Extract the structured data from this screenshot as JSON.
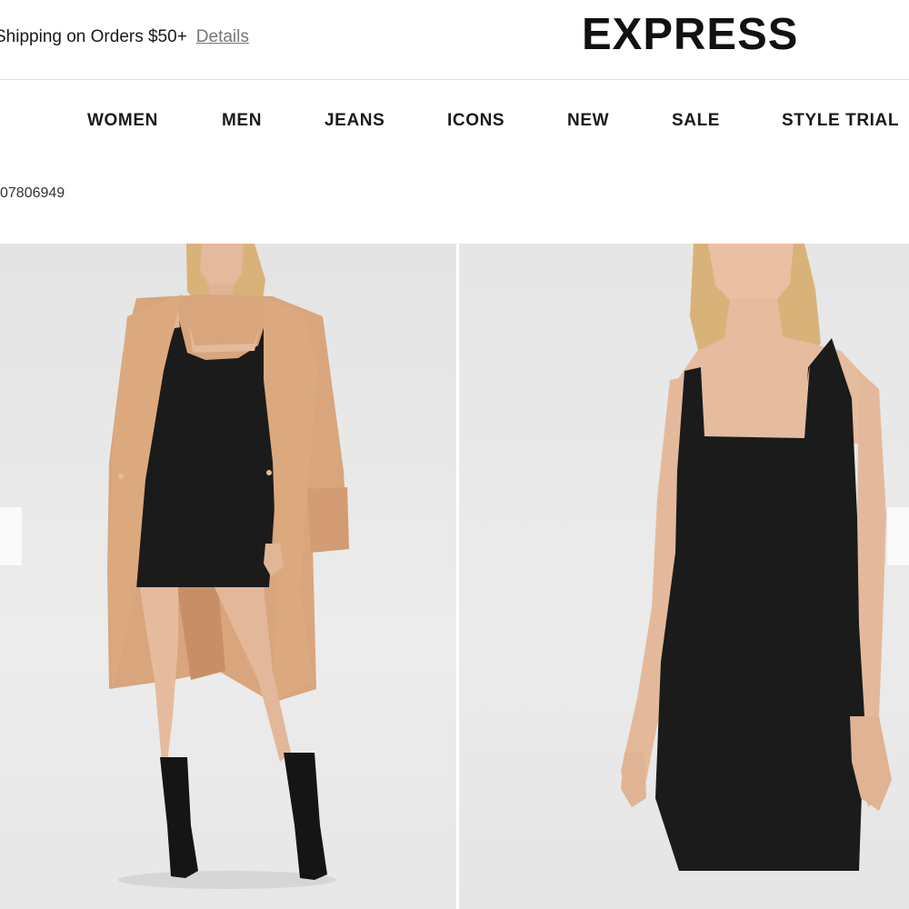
{
  "header": {
    "promo_text": "Shipping on Orders $50+",
    "promo_link": "Details",
    "logo": "EXPRESS"
  },
  "nav": {
    "items": [
      "WOMEN",
      "MEN",
      "JEANS",
      "ICONS",
      "NEW",
      "SALE",
      "STYLE TRIAL"
    ]
  },
  "product": {
    "style_number": "07806949"
  },
  "gallery": {
    "icons": {
      "prev": "chevron-left-icon",
      "next": "chevron-right-icon"
    }
  },
  "colors": {
    "coat": "#d9a57c",
    "dress": "#1b1b1b",
    "skin": "#e9c0a4",
    "hair": "#d9b27a",
    "background": "#e8e8e8"
  }
}
